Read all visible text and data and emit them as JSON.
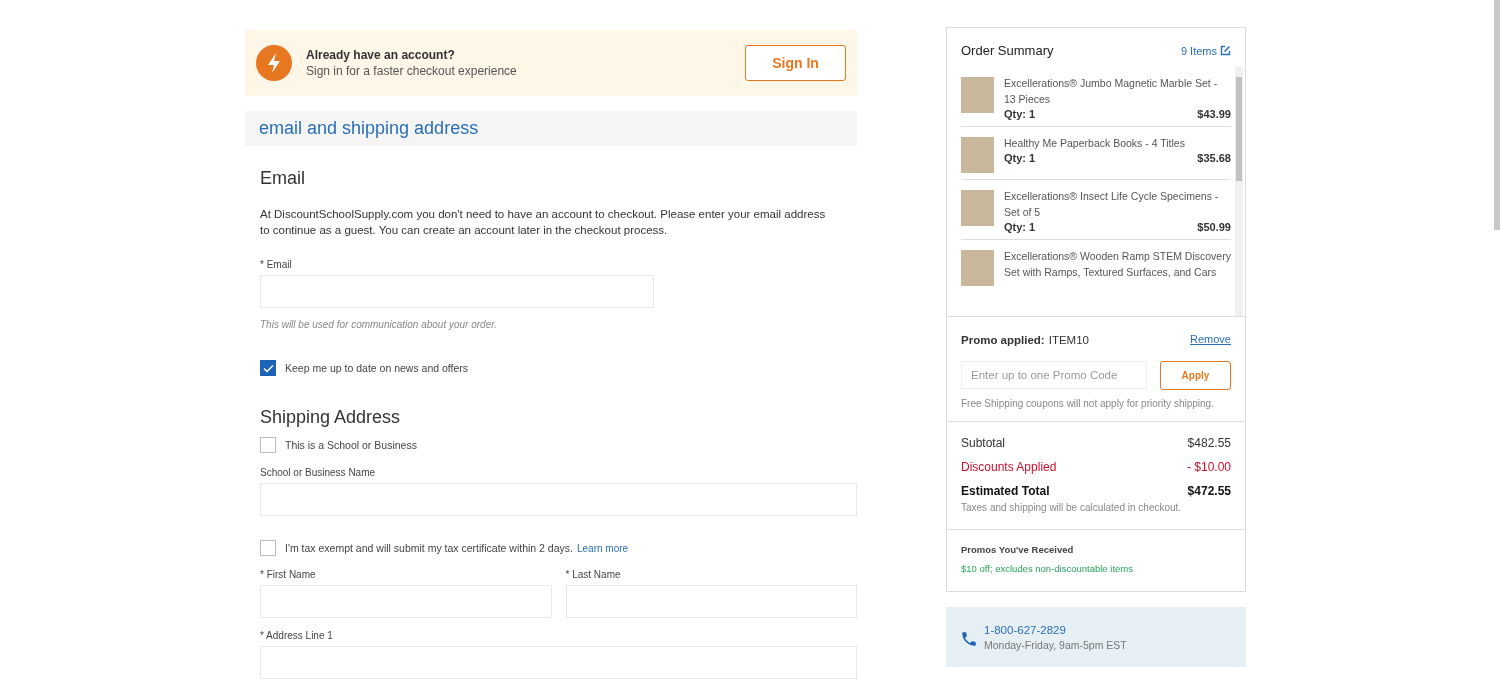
{
  "signin_banner": {
    "title": "Already have an account?",
    "subtitle": "Sign in for a faster checkout experience",
    "button": "Sign In"
  },
  "section_title": "email and shipping address",
  "email_section": {
    "heading": "Email",
    "description": "At DiscountSchoolSupply.com you don't need to have an account to checkout. Please enter your email address to continue as a guest. You can create an account later in the checkout process.",
    "field_label": "* Email",
    "hint": "This will be used for communication about your order.",
    "newsletter": {
      "label": "Keep me up to date on news and offers",
      "checked": true
    }
  },
  "shipping_section": {
    "heading": "Shipping Address",
    "business": {
      "label": "This is a School or Business",
      "checked": false
    },
    "business_name_label": "School or Business Name",
    "tax_exempt": {
      "label": "I'm tax exempt and will submit my tax certificate within 2 days.",
      "link": "Learn more",
      "checked": false
    },
    "first_name_label": "* First Name",
    "last_name_label": "* Last Name",
    "address_label": "* Address Line 1"
  },
  "order_summary": {
    "title": "Order Summary",
    "items_link": "9 Items",
    "items": [
      {
        "name": "Excellerations® Jumbo Magnetic Marble Set - 13 Pieces",
        "qty": "Qty: 1",
        "price": "$43.99"
      },
      {
        "name": "Healthy Me Paperback Books - 4 Titles",
        "qty": "Qty: 1",
        "price": "$35.68"
      },
      {
        "name": "Excellerations® Insect Life Cycle Specimens - Set of 5",
        "qty": "Qty: 1",
        "price": "$50.99"
      },
      {
        "name": "Excellerations® Wooden Ramp STEM Discovery Set with Ramps, Textured Surfaces, and Cars"
      }
    ],
    "promo_label": "Promo applied:",
    "promo_code": "ITEM10",
    "remove": "Remove",
    "promo_placeholder": "Enter up to one Promo Code",
    "apply": "Apply",
    "promo_note": "Free Shipping coupons will not apply for priority shipping.",
    "totals": [
      {
        "label": "Subtotal",
        "value": "$482.55",
        "kind": "normal"
      },
      {
        "label": "Discounts Applied",
        "value": "- $10.00",
        "kind": "discount"
      },
      {
        "label": "Estimated Total",
        "value": "$472.55",
        "kind": "total"
      }
    ],
    "tax_note": "Taxes and shipping will be calculated in checkout.",
    "promos_heading": "Promos You've Received",
    "promos_text": "$10 off; excludes non-discountable items"
  },
  "contact": {
    "phone": "1-800-627-2829",
    "hours": "Monday-Friday, 9am-5pm EST"
  }
}
